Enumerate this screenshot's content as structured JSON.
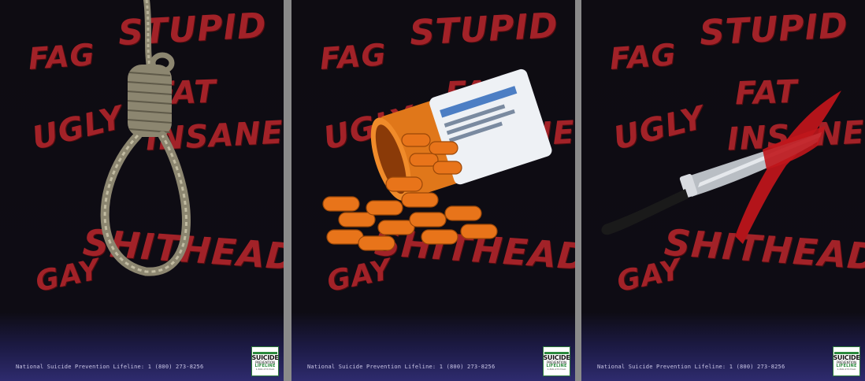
{
  "posters": [
    {
      "prop_icon": "noose-icon",
      "words": {
        "fag": "Fag",
        "stupid": "Stupid",
        "fat": "Fat",
        "ugly": "Ugly",
        "insane": "Insane",
        "shithead": "Shithead",
        "gay": "Gay"
      },
      "footer": "National Suicide Prevention Lifeline: 1 (800) 273-8256",
      "logo": {
        "line1": "SUICIDE",
        "line2": "PREVENTION",
        "line3": "LIFELINE",
        "line4": "1-800-273-TALK"
      }
    },
    {
      "prop_icon": "pill-bottle-icon",
      "words": {
        "fag": "Fag",
        "stupid": "Stupid",
        "fat": "Fat",
        "ugly": "Ugly",
        "insane": "Insane",
        "shithead": "Shithead",
        "gay": "Gay"
      },
      "footer": "National Suicide Prevention Lifeline: 1 (800) 273-8256",
      "logo": {
        "line1": "SUICIDE",
        "line2": "PREVENTION",
        "line3": "LIFELINE",
        "line4": "1-800-273-TALK"
      }
    },
    {
      "prop_icon": "bloody-knife-icon",
      "words": {
        "fag": "Fag",
        "stupid": "Stupid",
        "fat": "Fat",
        "ugly": "Ugly",
        "insane": "Insane",
        "shithead": "Shithead",
        "gay": "Gay"
      },
      "footer": "National Suicide Prevention Lifeline: 1 (800) 273-8256",
      "logo": {
        "line1": "SUICIDE",
        "line2": "PREVENTION",
        "line3": "LIFELINE",
        "line4": "1-800-273-TALK"
      }
    }
  ],
  "colors": {
    "word_red": "#b3252b",
    "poster_background": "#0e0c12",
    "footer_gradient": "#2e2b6e",
    "logo_green": "#2c8a3e"
  }
}
